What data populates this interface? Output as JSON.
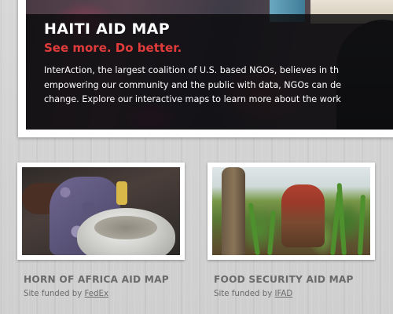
{
  "hero": {
    "title": "HAITI AID MAP",
    "tagline": "See more. Do better.",
    "body_lines": [
      "InterAction, the largest coalition of U.S. based NGOs, believes in th",
      "empowering our community and the public with data, NGOs can de",
      "change. Explore our interactive maps to learn more about the work"
    ],
    "tagline_color": "#e23b3b"
  },
  "maps": [
    {
      "title": "HORN OF AFRICA AID MAP",
      "credit_prefix": "Site funded by",
      "funder": "FedEx"
    },
    {
      "title": "FOOD SECURITY AID MAP",
      "credit_prefix": "Site funded by",
      "funder": "IFAD"
    }
  ]
}
